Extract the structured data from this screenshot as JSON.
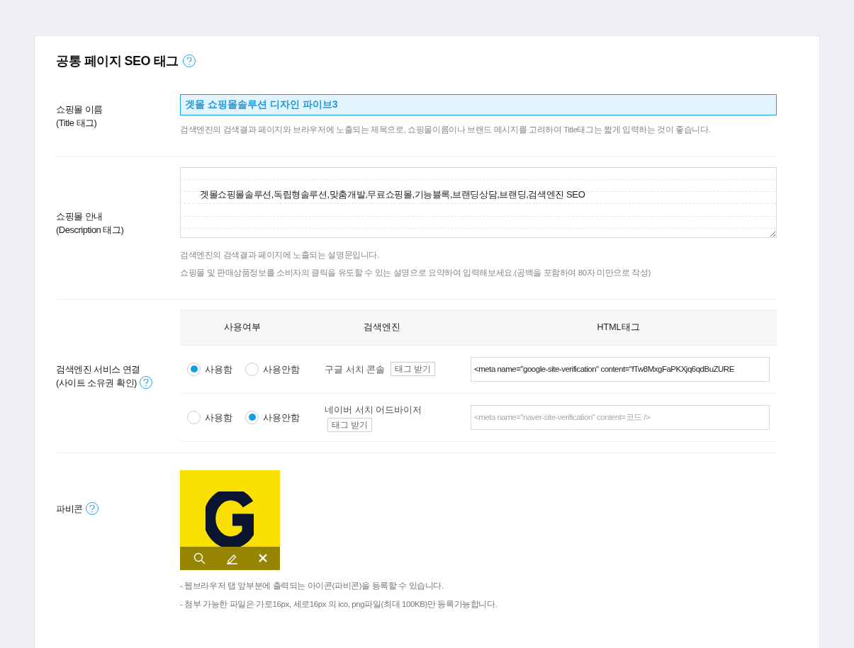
{
  "section": {
    "title": "공통 페이지 SEO 태그"
  },
  "title_tag": {
    "label": "쇼핑몰 이름",
    "sublabel": "(Title 태그)",
    "value": "겟몰 쇼핑몰솔루션 디자인 파이브3",
    "hint": "검색엔진의 검색결과 페이지와 브라우저에 노출되는 제목으로, 쇼핑몰이름이나 브랜드 메시지를 고려하여 Title태그는 짧게 입력하는 것이 좋습니다."
  },
  "description_tag": {
    "label": "쇼핑몰 안내",
    "sublabel": "(Description 태그)",
    "value": "겟몰쇼핑몰솔루션,독립형솔루션,맞춤개발,무료쇼핑몰,기능블록,브랜딩상담,브랜딩,검색엔진 SEO",
    "hints": [
      "검색엔진의 검색결과 페이지에 노출되는 설명문입니다.",
      "쇼핑몰 및 판매상품정보를 소비자의 클릭을 유도할 수 있는 설명으로 요약하여 입력해보세요.(공백을 포함하여 80자 미만으로 작성)"
    ]
  },
  "search_engines": {
    "label": "검색엔진 서비스 연결",
    "sublabel": "(사이트 소유권 확인)",
    "columns": [
      "사용여부",
      "검색엔진",
      "HTML태그"
    ],
    "rows": [
      {
        "options": [
          {
            "label": "사용함",
            "selected": true
          },
          {
            "label": "사용안함",
            "selected": false
          }
        ],
        "engine": "구글 서치 콘솔",
        "button": "태그 받기",
        "value": "<meta name=\"google-site-verification\" content=\"fTw8MxgFaPKXjq6qdBuZURE"
      },
      {
        "options": [
          {
            "label": "사용함",
            "selected": false
          },
          {
            "label": "사용안함",
            "selected": true
          }
        ],
        "engine": "네이버 서치 어드바이저",
        "button": "태그 받기",
        "placeholder": "<meta name=\"naver-site-verification\" content=코드 />"
      }
    ]
  },
  "favicon": {
    "label": "파비콘",
    "notes": [
      "- 웹브라우저 탭 앞부분에 출력되는 아이콘(파비콘)을 등록할 수 있습니다.",
      "- 첨부 가능한 파일은 가로16px, 세로16px 의 ico, png파일(최대 100KB)만 등록가능합니다."
    ]
  }
}
